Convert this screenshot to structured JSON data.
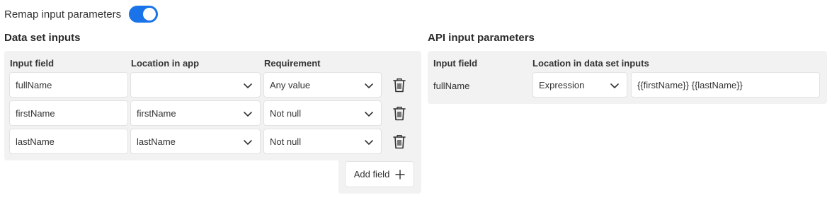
{
  "remap": {
    "label": "Remap input parameters",
    "enabled": true,
    "accent_color": "#1a73e8"
  },
  "data_set": {
    "title": "Data set inputs",
    "headers": {
      "input_field": "Input field",
      "location": "Location in app",
      "requirement": "Requirement"
    },
    "rows": [
      {
        "input_field": "fullName",
        "location": "",
        "requirement": "Any value"
      },
      {
        "input_field": "firstName",
        "location": "firstName",
        "requirement": "Not null"
      },
      {
        "input_field": "lastName",
        "location": "lastName",
        "requirement": "Not null"
      }
    ],
    "add_button": {
      "label": "Add field",
      "icon": "plus-icon"
    },
    "row_icon": "trash-icon"
  },
  "api": {
    "title": "API input parameters",
    "headers": {
      "input_field": "Input field",
      "location": "Location in data set inputs"
    },
    "rows": [
      {
        "input_field": "fullName",
        "location_type": "Expression",
        "expression": "{{firstName}} {{lastName}}"
      }
    ]
  }
}
